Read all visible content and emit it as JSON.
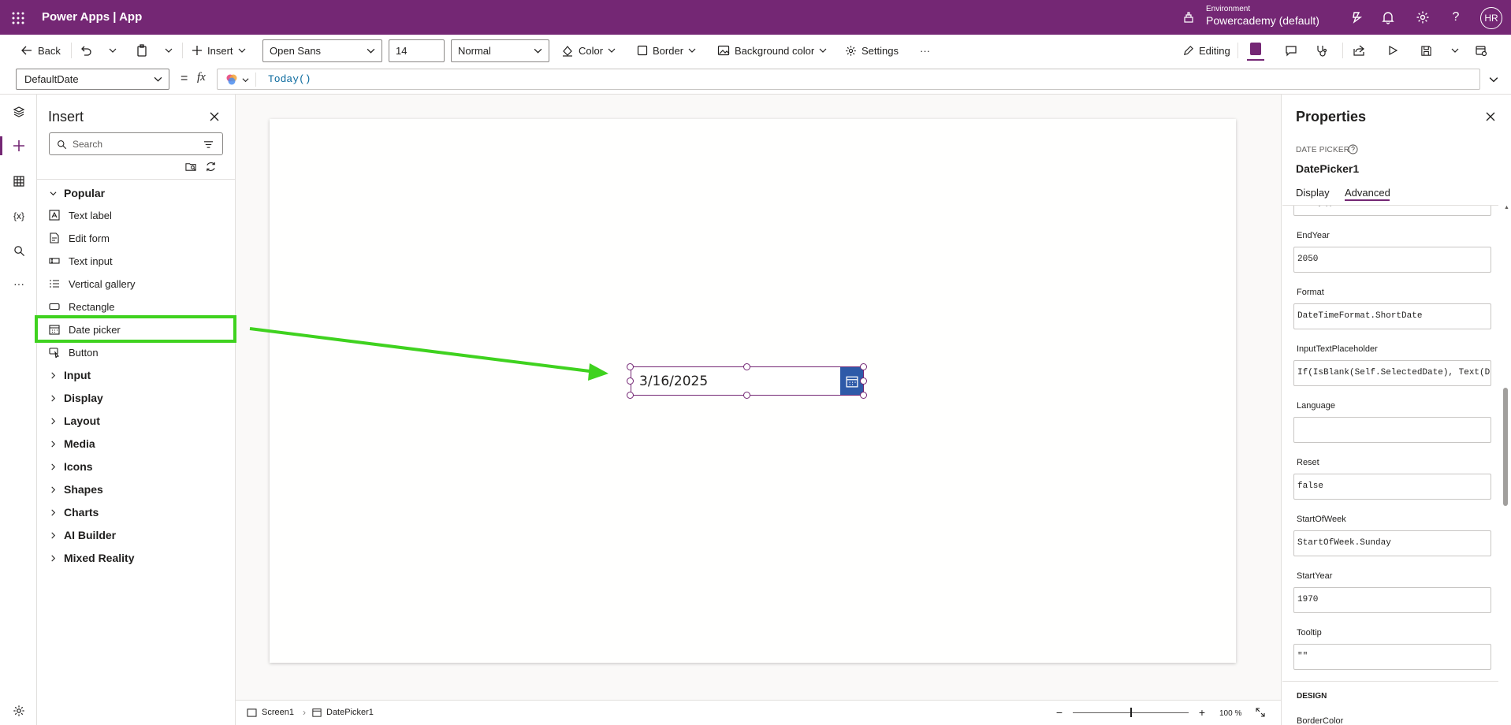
{
  "topbar": {
    "app_title": "Power Apps  |  App",
    "env_label": "Environment",
    "env_name": "Powercademy (default)",
    "avatar_initials": "HR",
    "bg_color": "#742774"
  },
  "commandbar": {
    "back": "Back",
    "insert": "Insert",
    "font_family": "Open Sans",
    "font_size": "14",
    "font_weight": "Normal",
    "color": "Color",
    "border": "Border",
    "background_color": "Background color",
    "settings": "Settings",
    "more": "···",
    "editing": "Editing"
  },
  "formulabar": {
    "property": "DefaultDate",
    "equals": "=",
    "fx": "fx",
    "formula": "Today()"
  },
  "insert_pane": {
    "title": "Insert",
    "search_placeholder": "Search",
    "popular_label": "Popular",
    "popular_items": [
      {
        "label": "Text label",
        "icon": "text-label-icon"
      },
      {
        "label": "Edit form",
        "icon": "edit-form-icon"
      },
      {
        "label": "Text input",
        "icon": "text-input-icon"
      },
      {
        "label": "Vertical gallery",
        "icon": "vertical-gallery-icon"
      },
      {
        "label": "Rectangle",
        "icon": "rectangle-icon"
      },
      {
        "label": "Date picker",
        "icon": "calendar-icon"
      },
      {
        "label": "Button",
        "icon": "button-icon"
      }
    ],
    "categories": [
      "Input",
      "Display",
      "Layout",
      "Media",
      "Icons",
      "Shapes",
      "Charts",
      "AI Builder",
      "Mixed Reality"
    ]
  },
  "canvas": {
    "datepicker_value": "3/16/2025",
    "highlight_color": "#3fd21f"
  },
  "statusbar": {
    "screen": "Screen1",
    "control": "DatePicker1",
    "zoom": "100 %",
    "zoom_level": 0.5
  },
  "properties": {
    "title": "Properties",
    "control_type": "DATE PICKER",
    "control_name": "DatePicker1",
    "tabs": [
      "Display",
      "Advanced"
    ],
    "active_tab": "Advanced",
    "partial_top_value": "Today()",
    "rows": [
      {
        "label": "EndYear",
        "value": "2050"
      },
      {
        "label": "Format",
        "value": "DateTimeFormat.ShortDate"
      },
      {
        "label": "InputTextPlaceholder",
        "value": "If(IsBlank(Self.SelectedDate), Text(D..."
      },
      {
        "label": "Language",
        "value": ""
      },
      {
        "label": "Reset",
        "value": "false"
      },
      {
        "label": "StartOfWeek",
        "value": "StartOfWeek.Sunday"
      },
      {
        "label": "StartYear",
        "value": "1970"
      },
      {
        "label": "Tooltip",
        "value": "\"\""
      }
    ],
    "design_section": "DESIGN",
    "design_first_label": "BorderColor"
  }
}
